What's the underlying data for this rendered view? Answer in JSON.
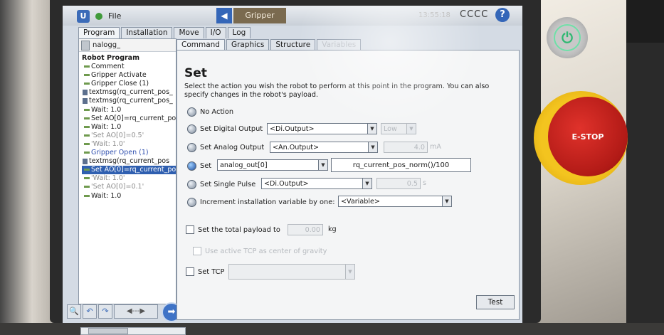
{
  "header": {
    "file_label": "File",
    "page_title": "Gripper",
    "clock": "13:55:18",
    "user": "CCCC",
    "help_glyph": "?"
  },
  "main_tabs": [
    "Program",
    "Installation",
    "Move",
    "I/O",
    "Log"
  ],
  "program": {
    "name": "nalogg_",
    "tree": [
      {
        "text": "Robot Program",
        "style": "head"
      },
      {
        "text": "Comment",
        "style": "normal"
      },
      {
        "text": "Gripper Activate",
        "style": "normal"
      },
      {
        "text": "Gripper Close (1)",
        "style": "normal"
      },
      {
        "text": "textmsg(rq_current_pos_",
        "style": "icon"
      },
      {
        "text": "textmsg(rq_current_pos_",
        "style": "icon"
      },
      {
        "text": "Wait: 1.0",
        "style": "normal"
      },
      {
        "text": "Set AO[0]=rq_current_po",
        "style": "normal"
      },
      {
        "text": "Wait: 1.0",
        "style": "normal"
      },
      {
        "text": "'Set AO[0]=0.5'",
        "style": "gray"
      },
      {
        "text": "'Wait: 1.0'",
        "style": "gray"
      },
      {
        "text": "Gripper Open (1)",
        "style": "blue"
      },
      {
        "text": "textmsg(rq_current_pos",
        "style": "icon"
      },
      {
        "text": "Set AO[0]=rq_current_po",
        "style": "selected"
      },
      {
        "text": "'Wait: 1.0'",
        "style": "gray"
      },
      {
        "text": "'Set AO[0]=0.1'",
        "style": "gray"
      },
      {
        "text": "Wait: 1.0",
        "style": "normal"
      }
    ],
    "next_glyph": "➡",
    "tools": [
      "🔍",
      "↶",
      "↷",
      "◀---▶"
    ]
  },
  "sub_tabs": [
    "Command",
    "Graphics",
    "Structure",
    "Variables"
  ],
  "set_panel": {
    "heading": "Set",
    "description": "Select the action you wish the robot to perform at this point in the program. You can also specify changes in the robot's payload.",
    "options": {
      "no_action": "No Action",
      "digital_output": "Set Digital Output",
      "analog_output": "Set Analog Output",
      "set": "Set",
      "single_pulse": "Set Single Pulse",
      "increment": "Increment installation variable by one:"
    },
    "digital_output_select": "<Di.Output>",
    "digital_value_select": "Low",
    "analog_output_select": "<An.Output>",
    "analog_value": "4.0",
    "analog_unit": "mA",
    "set_variable_select": "analog_out[0]",
    "set_expression": "rq_current_pos_norm()/100",
    "pulse_output_select": "<Di.Output>",
    "pulse_value": "0.5",
    "pulse_unit": "s",
    "variable_select": "<Variable>",
    "payload_label": "Set the total payload to",
    "payload_value": "0.00",
    "payload_unit": "kg",
    "tcp_cog_label": "Use active TCP as center of gravity",
    "set_tcp_label": "Set TCP",
    "test_button": "Test"
  },
  "hardware": {
    "estop_label": "E-STOP"
  }
}
